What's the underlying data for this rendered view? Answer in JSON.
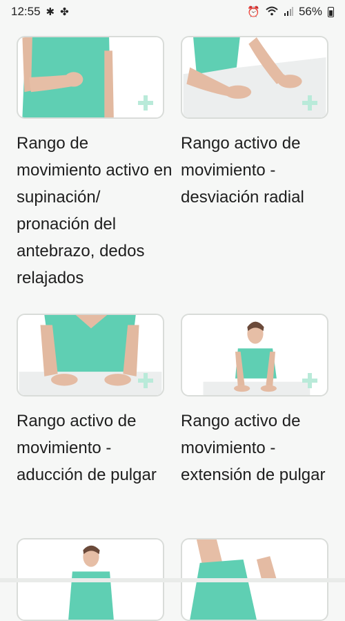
{
  "status_bar": {
    "time": "12:55",
    "left_icons": [
      "bluetooth-icon",
      "pinwheel-icon"
    ],
    "right_icons": [
      "alarm-icon",
      "wifi-icon",
      "signal-icon"
    ],
    "battery_percent": "56%"
  },
  "colors": {
    "background": "#f6f7f6",
    "card_border": "#d9dcd9",
    "shirt_teal": "#5fcfb3",
    "plus_accent": "#b9ead9",
    "text": "#1e1e1e"
  },
  "exercises": [
    {
      "title": "Rango de movimiento activo en supinación/ pronación del antebrazo, dedos relajados",
      "image": "forearm-rotation"
    },
    {
      "title": "Rango activo de movimiento - desviación radial",
      "image": "hands-on-table"
    },
    {
      "title": "Rango activo de movimiento - aducción de pulgar",
      "image": "torso-hands-table"
    },
    {
      "title": "Rango activo de movimiento - extensión de pulgar",
      "image": "seated-woman"
    },
    {
      "title": "",
      "image": "seated-woman-partial"
    },
    {
      "title": "",
      "image": "profile-hand-raised"
    }
  ]
}
